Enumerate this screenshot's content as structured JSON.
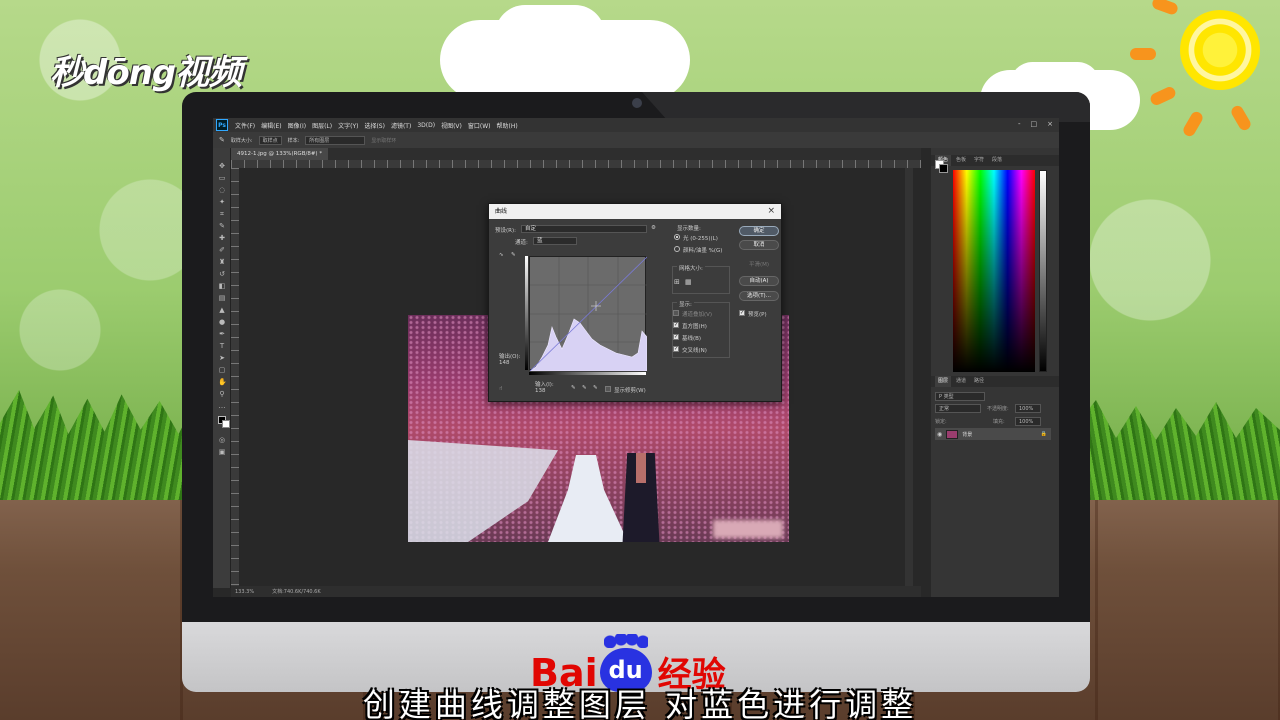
{
  "branding": {
    "channel_logo": "秒dōng视频",
    "footer_bai": "Bai",
    "footer_du": "du",
    "footer_jingyan": "经验"
  },
  "subtitle": "创建曲线调整图层  对蓝色进行调整",
  "photoshop": {
    "menu": [
      "文件(F)",
      "编辑(E)",
      "图像(I)",
      "图层(L)",
      "文字(Y)",
      "选择(S)",
      "滤镜(T)",
      "3D(D)",
      "视图(V)",
      "窗口(W)",
      "帮助(H)"
    ],
    "window_controls": [
      "-",
      "□",
      "×"
    ],
    "options_bar": {
      "sample_size_label": "取样大小:",
      "sample_size_value": "取样点",
      "sample_label": "样本:",
      "sample_value": "所有图层",
      "show_ring": "显示取样环"
    },
    "document_tab": "4912-1.jpg @ 133%(RGB/8#) *",
    "status": {
      "zoom": "133.3%",
      "doc_size": "文档:740.6K/740.6K"
    },
    "panels": {
      "color_tabs": [
        "颜色",
        "色板",
        "字符",
        "段落"
      ],
      "layer_tabs": [
        "图层",
        "通道",
        "路径"
      ],
      "layer_kind": "P 类型",
      "blend_mode": "正常",
      "opacity_label": "不透明度:",
      "opacity_value": "100%",
      "lock_label": "锁定:",
      "fill_label": "填充:",
      "fill_value": "100%",
      "layer_name": "背景"
    },
    "curves_dialog": {
      "title": "曲线",
      "preset_label": "预设(R):",
      "preset_value": "自定",
      "channel_label": "通道:",
      "channel_value": "蓝",
      "output_label": "输出(O):",
      "output_value": "148",
      "input_label": "输入(I):",
      "input_value": "138",
      "show_clipping": "显示修剪(W)",
      "display_amount_label": "显示数量:",
      "light_option": "光 (0-255)(L)",
      "pigment_option": "颜料/油墨 %(G)",
      "grid_size_label": "网格大小:",
      "show_label": "显示:",
      "show_options": [
        "通道叠加(V)",
        "直方图(H)",
        "基线(B)",
        "交叉线(N)"
      ],
      "show_options_checked": [
        false,
        true,
        true,
        true
      ],
      "buttons": {
        "ok": "确定",
        "cancel": "取消",
        "smooth": "平滑(M)",
        "auto": "自动(A)",
        "options": "选项(T)..."
      },
      "preview": "预览(P)"
    }
  }
}
